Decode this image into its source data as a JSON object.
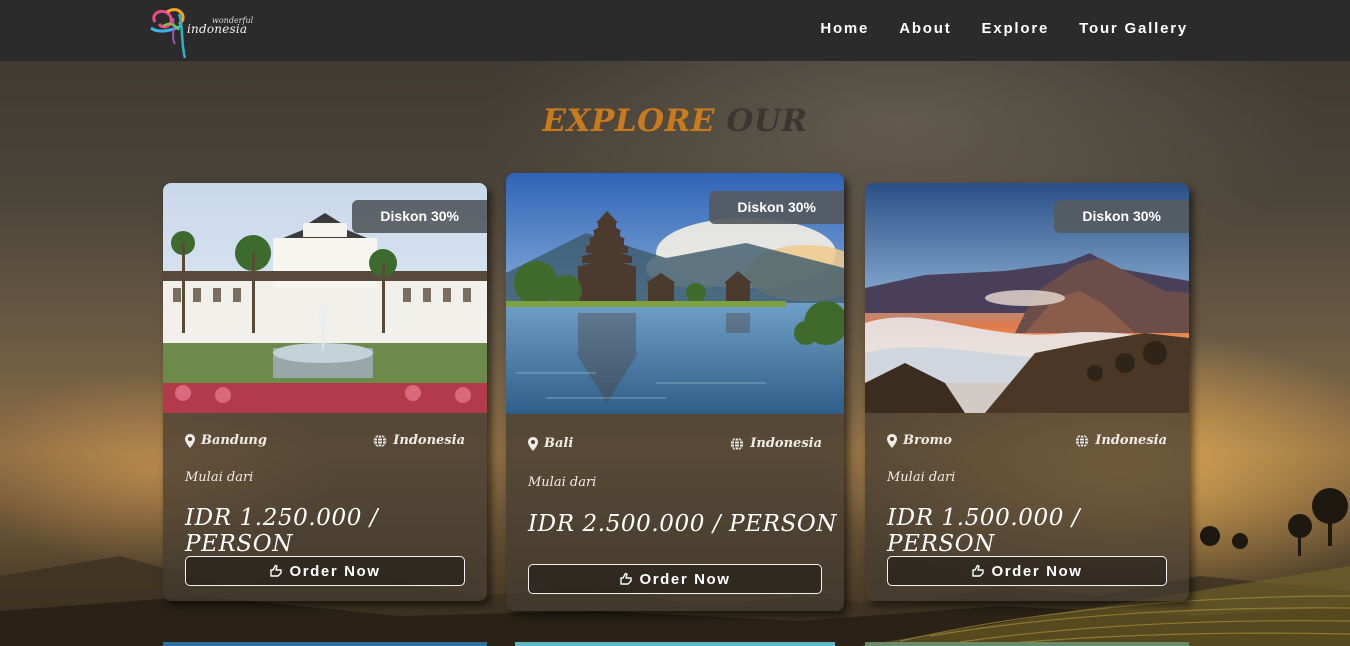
{
  "brand": {
    "logo_small": "wonderful",
    "logo_big": "indonesia"
  },
  "nav": {
    "items": [
      {
        "label": "Home"
      },
      {
        "label": "About"
      },
      {
        "label": "Explore"
      },
      {
        "label": "Tour Gallery"
      }
    ]
  },
  "section": {
    "title_part1": "EXPLORE",
    "title_part2": "OUR"
  },
  "cards": [
    {
      "badge": "Diskon 30%",
      "location": "Bandung",
      "country": "Indonesia",
      "starting_label": "Mulai dari",
      "price": "IDR 1.250.000 / PERSON",
      "button_label": "Order Now"
    },
    {
      "badge": "Diskon 30%",
      "location": "Bali",
      "country": "Indonesia",
      "starting_label": "Mulai dari",
      "price": "IDR 2.500.000 / PERSON",
      "button_label": "Order Now"
    },
    {
      "badge": "Diskon 30%",
      "location": "Bromo",
      "country": "Indonesia",
      "starting_label": "Mulai dari",
      "price": "IDR 1.500.000 / PERSON",
      "button_label": "Order Now"
    }
  ],
  "icons": {
    "location": "map-pin-icon",
    "country": "globe-icon",
    "order": "hand-pointer-icon"
  },
  "colors": {
    "navbar_bg": "#2b2b2b",
    "title_accent": "#c97a1c",
    "title_dark": "#3b3631",
    "badge_bg": "#555a60"
  }
}
